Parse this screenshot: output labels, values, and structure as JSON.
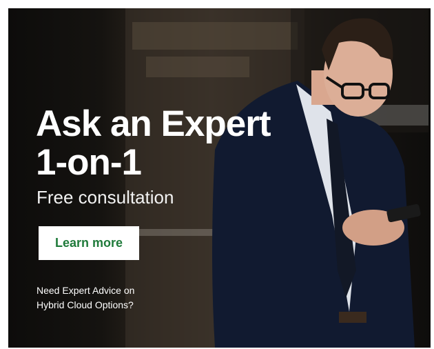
{
  "ad": {
    "headline_line1": "Ask an Expert",
    "headline_line2": "1-on-1",
    "subheadline": "Free consultation",
    "cta_label": "Learn more",
    "tagline_line1": "Need Expert Advice on",
    "tagline_line2": "Hybrid Cloud Options?"
  },
  "colors": {
    "background": "#0e0d0c",
    "text": "#ffffff",
    "button_background": "#ffffff",
    "button_text": "#1f7a3a",
    "suit": "#101a33"
  }
}
